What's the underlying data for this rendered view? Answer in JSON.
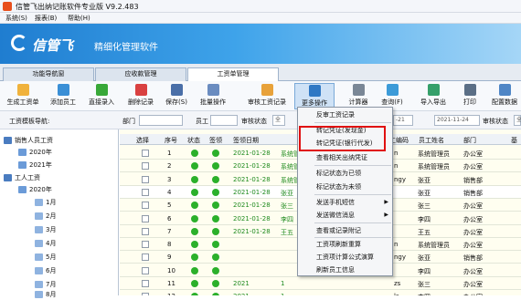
{
  "app": {
    "title": "信管飞出纳记账软件专业版 V9.2.483",
    "brand": "信管飞",
    "slogan": "精细化管理软件"
  },
  "menu": [
    "系统(S)",
    "报表(B)",
    "帮助(H)"
  ],
  "tabs": [
    "功能导航窗",
    "应收款管理",
    "工资单管理"
  ],
  "toolbar": [
    "生成工资单",
    "添加员工",
    "直接录入",
    "删除记录",
    "保存(S)",
    "批量操作",
    "审核工资记录",
    "更多操作",
    "计算器",
    "查询(F)",
    "导入导出",
    "打印",
    "配置数据"
  ],
  "filter": {
    "template_label": "工资模板导航:",
    "dept_label": "部门",
    "staff_label": "员工",
    "verify_label": "审核状态",
    "verify_placeholder": "全",
    "date_to": "-21",
    "date_end": "2021-11-24",
    "verify2_label": "审核状态",
    "verify2_value": "全"
  },
  "tree": [
    "销售人员工资",
    "2020年",
    "2021年",
    "工人工资",
    "2020年",
    "1月",
    "2月",
    "3月",
    "4月",
    "5月",
    "6月",
    "7月",
    "8月"
  ],
  "grid": {
    "headers": [
      "选择",
      "序号",
      "状态",
      "签领",
      "签领日期",
      "",
      "职",
      "工编码",
      "员工姓名",
      "部门",
      "基"
    ],
    "rows": [
      {
        "no": "1",
        "date": "2021-01-28",
        "c1": "系统管",
        "c2": "n",
        "name": "系统管理员",
        "dept": "办公室"
      },
      {
        "no": "2",
        "date": "2021-01-28",
        "c1": "系统管",
        "c2": "n",
        "name": "系统管理员",
        "dept": "办公室"
      },
      {
        "no": "3",
        "date": "2021-01-28",
        "c1": "系统管",
        "c2": "ngy",
        "name": "张亚",
        "dept": "销售部"
      },
      {
        "no": "4",
        "date": "2021-01-28",
        "c1": "张亚",
        "c2": "",
        "name": "张亚",
        "dept": "销售部"
      },
      {
        "no": "5",
        "date": "2021-01-28",
        "c1": "张三",
        "c2": "",
        "name": "张三",
        "dept": "办公室"
      },
      {
        "no": "6",
        "date": "2021-01-28",
        "c1": "李四",
        "c2": "",
        "name": "李四",
        "dept": "办公室"
      },
      {
        "no": "7",
        "date": "2021-01-28",
        "c1": "王五",
        "c2": "",
        "name": "王五",
        "dept": "办公室"
      },
      {
        "no": "8",
        "date": "",
        "c1": "",
        "c2": "n",
        "name": "系统管理员",
        "dept": "办公室"
      },
      {
        "no": "9",
        "date": "",
        "c1": "",
        "c2": "ngy",
        "name": "张亚",
        "dept": "销售部"
      },
      {
        "no": "10",
        "date": "",
        "c1": "",
        "c2": "",
        "name": "李四",
        "dept": "办公室"
      },
      {
        "no": "11",
        "date": "2021",
        "c1": "1",
        "c2": "zs",
        "name": "张三",
        "dept": "办公室"
      },
      {
        "no": "12",
        "date": "2021",
        "c1": "1",
        "c2": "ls",
        "name": "李四",
        "dept": "办公室"
      }
    ]
  },
  "context_menu": [
    "反审工资记录",
    "转记凭证(发现金)",
    "转记凭证(银行代发)",
    "查看相关出纳凭证",
    "标记状态为已领",
    "标记状态为未领",
    "发送手机短信",
    "发送微信消息",
    "查看或记录附记",
    "工资项刷新重算",
    "工资项计算公式演算",
    "刷新员工信息"
  ]
}
